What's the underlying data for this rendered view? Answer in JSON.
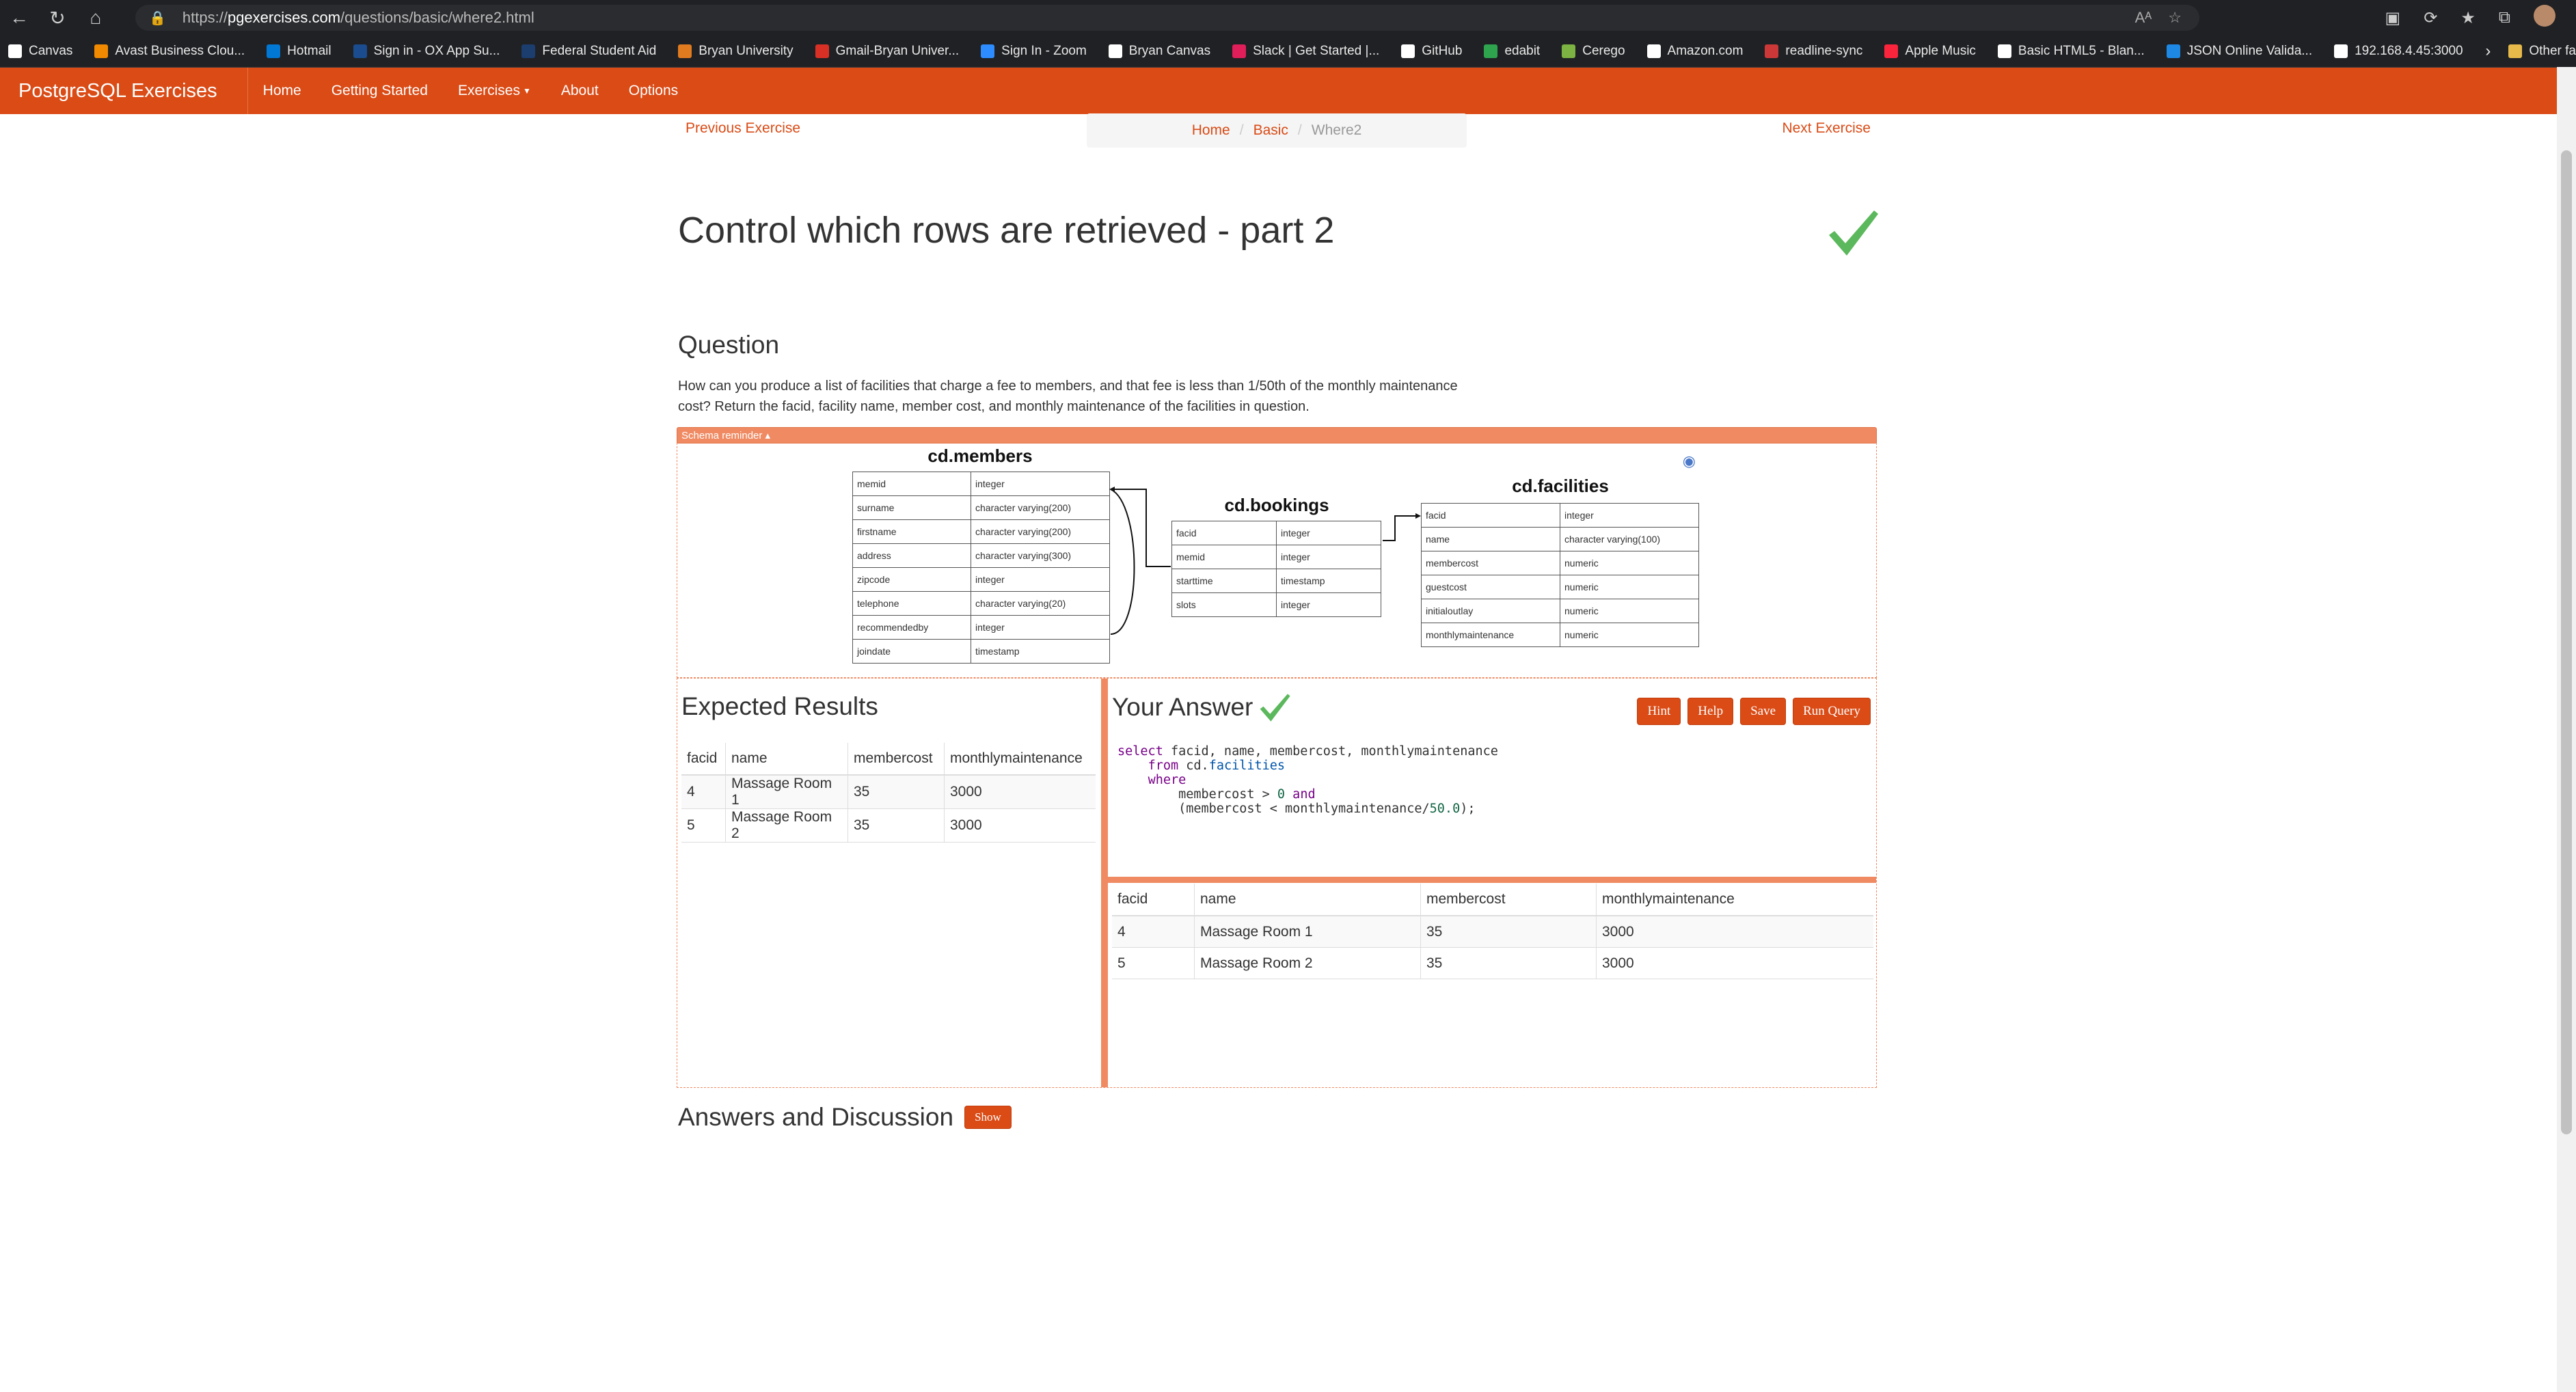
{
  "browser": {
    "url_protocol": "https://",
    "url_domain": "pgexercises.com",
    "url_path": "/questions/basic/where2.html",
    "read_aloud": "Aᴬ",
    "bookmarks": [
      {
        "label": "Canvas",
        "icon_color": "#ffffff"
      },
      {
        "label": "Avast Business Clou...",
        "icon_color": "#f18a00"
      },
      {
        "label": "Hotmail",
        "icon_color": "#0078d4"
      },
      {
        "label": "Sign in - OX App Su...",
        "icon_color": "#1b4c8f"
      },
      {
        "label": "Federal Student Aid",
        "icon_color": "#1b3e6f"
      },
      {
        "label": "Bryan University",
        "icon_color": "#e07b20"
      },
      {
        "label": "Gmail-Bryan Univer...",
        "icon_color": "#d93025"
      },
      {
        "label": "Sign In - Zoom",
        "icon_color": "#2d8cff"
      },
      {
        "label": "Bryan Canvas",
        "icon_color": "#ffffff"
      },
      {
        "label": "Slack | Get Started |...",
        "icon_color": "#e01e5a"
      },
      {
        "label": "GitHub",
        "icon_color": "#ffffff"
      },
      {
        "label": "edabit",
        "icon_color": "#2ea44f"
      },
      {
        "label": "Cerego",
        "icon_color": "#7cb342"
      },
      {
        "label": "Amazon.com",
        "icon_color": "#ffffff"
      },
      {
        "label": "readline-sync",
        "icon_color": "#cb3837"
      },
      {
        "label": "Apple Music",
        "icon_color": "#fa243c"
      },
      {
        "label": "Basic HTML5 - Blan...",
        "icon_color": "#ffffff"
      },
      {
        "label": "JSON Online Valida...",
        "icon_color": "#1e88e5"
      },
      {
        "label": "192.168.4.45:3000",
        "icon_color": "#ffffff"
      }
    ],
    "other_favorites": "Other fa"
  },
  "app": {
    "brand": "PostgreSQL Exercises",
    "accent_color": "#da4b16",
    "nav": [
      "Home",
      "Getting Started",
      "Exercises",
      "About",
      "Options"
    ]
  },
  "pager": {
    "previous": "Previous Exercise",
    "next": "Next Exercise",
    "breadcrumb": [
      "Home",
      "Basic",
      "Where2"
    ]
  },
  "page_title": "Control which rows are retrieved - part 2",
  "question": {
    "heading": "Question",
    "text": "How can you produce a list of facilities that charge a fee to members, and that fee is less than 1/50th of the monthly maintenance cost? Return the facid, facility name, member cost, and monthly maintenance of the facilities in question."
  },
  "schema": {
    "label": "Schema reminder ▴",
    "members": {
      "title": "cd.members",
      "rows": [
        [
          "memid",
          "integer"
        ],
        [
          "surname",
          "character varying(200)"
        ],
        [
          "firstname",
          "character varying(200)"
        ],
        [
          "address",
          "character varying(300)"
        ],
        [
          "zipcode",
          "integer"
        ],
        [
          "telephone",
          "character varying(20)"
        ],
        [
          "recommendedby",
          "integer"
        ],
        [
          "joindate",
          "timestamp"
        ]
      ]
    },
    "bookings": {
      "title": "cd.bookings",
      "rows": [
        [
          "facid",
          "integer"
        ],
        [
          "memid",
          "integer"
        ],
        [
          "starttime",
          "timestamp"
        ],
        [
          "slots",
          "integer"
        ]
      ]
    },
    "facilities": {
      "title": "cd.facilities",
      "rows": [
        [
          "facid",
          "integer"
        ],
        [
          "name",
          "character varying(100)"
        ],
        [
          "membercost",
          "numeric"
        ],
        [
          "guestcost",
          "numeric"
        ],
        [
          "initialoutlay",
          "numeric"
        ],
        [
          "monthlymaintenance",
          "numeric"
        ]
      ]
    }
  },
  "expected": {
    "heading": "Expected Results",
    "columns": [
      "facid",
      "name",
      "membercost",
      "monthlymaintenance"
    ],
    "rows": [
      [
        "4",
        "Massage Room 1",
        "35",
        "3000"
      ],
      [
        "5",
        "Massage Room 2",
        "35",
        "3000"
      ]
    ]
  },
  "your_answer": {
    "heading": "Your Answer",
    "buttons": {
      "hint": "Hint",
      "help": "Help",
      "save": "Save",
      "run": "Run Query"
    },
    "code": {
      "l1_kw": "select",
      "l1_rest": " facid, name, membercost, monthlymaintenance",
      "l2_indent": "    ",
      "l2_kw": "from",
      "l2_schema": " cd.",
      "l2_table": "facilities",
      "l3_indent": "    ",
      "l3_kw": "where",
      "l4_text": "        membercost > ",
      "l4_num": "0",
      "l4_and": " and",
      "l5_text": "        (membercost < monthlymaintenance/",
      "l5_num": "50.0",
      "l5_end": ");"
    },
    "columns": [
      "facid",
      "name",
      "membercost",
      "monthlymaintenance"
    ],
    "rows": [
      [
        "4",
        "Massage Room 1",
        "35",
        "3000"
      ],
      [
        "5",
        "Massage Room 2",
        "35",
        "3000"
      ]
    ]
  },
  "answers_discussion": {
    "heading": "Answers and Discussion",
    "show": "Show"
  },
  "check_color": "#5cb85c"
}
